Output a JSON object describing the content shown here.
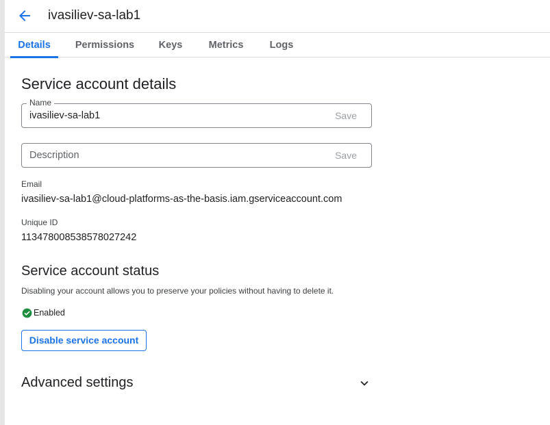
{
  "header": {
    "title": "ivasiliev-sa-lab1",
    "back_icon": "arrow-left-icon",
    "accent_color": "#1a73e8"
  },
  "tabs": [
    {
      "label": "Details",
      "active": true
    },
    {
      "label": "Permissions",
      "active": false
    },
    {
      "label": "Keys",
      "active": false
    },
    {
      "label": "Metrics",
      "active": false
    },
    {
      "label": "Logs",
      "active": false
    }
  ],
  "details": {
    "title": "Service account details",
    "name_field": {
      "label": "Name",
      "value": "ivasiliev-sa-lab1",
      "save_label": "Save"
    },
    "description_field": {
      "placeholder": "Description",
      "value": "",
      "save_label": "Save"
    },
    "email": {
      "label": "Email",
      "value": "ivasiliev-sa-lab1@cloud-platforms-as-the-basis.iam.gserviceaccount.com"
    },
    "unique_id": {
      "label": "Unique ID",
      "value": "113478008538578027242"
    }
  },
  "status": {
    "title": "Service account status",
    "helper": "Disabling your account allows you to preserve your policies without having to delete it.",
    "state_label": "Enabled",
    "state_icon": "check-circle-icon",
    "state_color": "#1e8e3e",
    "disable_button_label": "Disable service account"
  },
  "advanced": {
    "title": "Advanced settings",
    "icon": "chevron-down-icon"
  }
}
